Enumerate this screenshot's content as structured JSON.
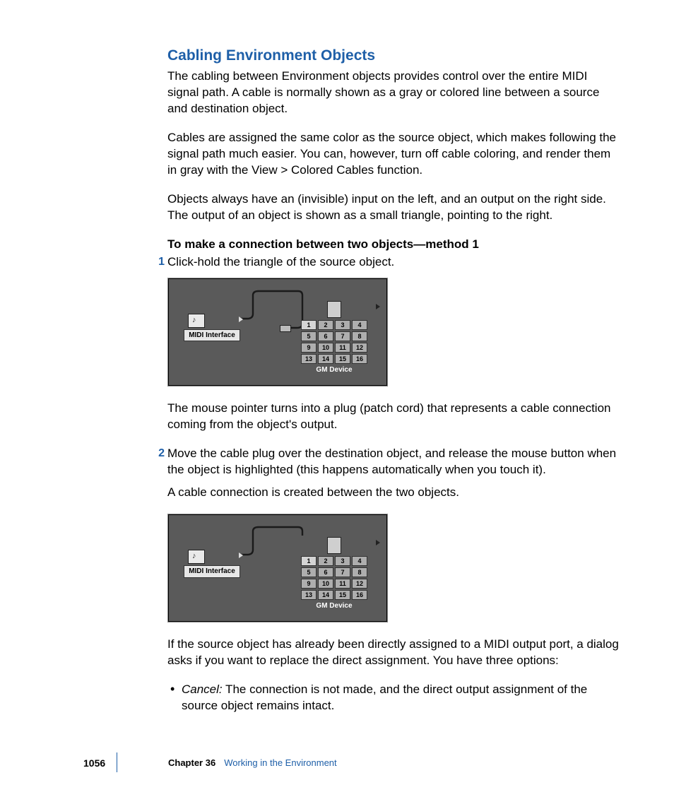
{
  "section": {
    "title": "Cabling Environment Objects",
    "p1": "The cabling between Environment objects provides control over the entire MIDI signal path. A cable is normally shown as a gray or colored line between a source and destination object.",
    "p2": "Cables are assigned the same color as the source object, which makes following the signal path much easier. You can, however, turn off cable coloring, and render them in gray with the View > Colored Cables function.",
    "p3": "Objects always have an (invisible) input on the left, and an output on the right side. The output of an object is shown as a small triangle, pointing to the right.",
    "method_heading": "To make a connection between two objects—method 1"
  },
  "steps": {
    "s1_num": "1",
    "s1_text": "Click-hold the triangle of the source object.",
    "s1_after": "The mouse pointer turns into a plug (patch cord) that represents a cable connection coming from the object's output.",
    "s2_num": "2",
    "s2_text": "Move the cable plug over the destination object, and release the mouse button when the object is highlighted (this happens automatically when you touch it).",
    "s2_text2": "A cable connection is created between the two objects.",
    "s2_after": "If the source object has already been directly assigned to a MIDI output port, a dialog asks if you want to replace the direct assignment. You have three options:"
  },
  "bullet": {
    "cancel_label": "Cancel:",
    "cancel_text": "  The connection is not made, and the direct output assignment of the source object remains intact."
  },
  "figure": {
    "midi_label": "MIDI Interface",
    "gm_label": "GM Device",
    "cells": [
      "1",
      "2",
      "3",
      "4",
      "5",
      "6",
      "7",
      "8",
      "9",
      "10",
      "11",
      "12",
      "13",
      "14",
      "15",
      "16"
    ]
  },
  "footer": {
    "page_number": "1056",
    "chapter_label": "Chapter 36",
    "chapter_title": "Working in the Environment"
  }
}
